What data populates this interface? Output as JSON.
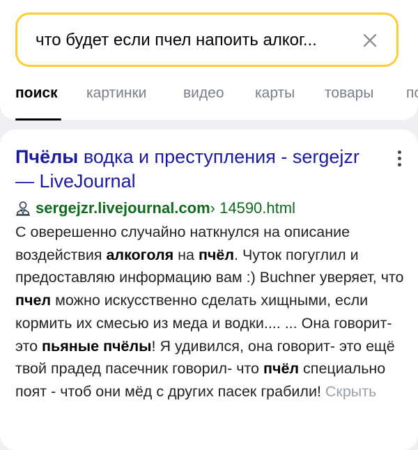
{
  "search": {
    "query": "что будет если пчел напоить алког..."
  },
  "tabs": [
    {
      "label": "поиск",
      "active": true
    },
    {
      "label": "картинки"
    },
    {
      "label": "видео"
    },
    {
      "label": "карты"
    },
    {
      "label": "товары"
    },
    {
      "label": "по"
    }
  ],
  "result": {
    "title_bold": "Пчёлы",
    "title_rest": " водка и преступления - sergejzr — LiveJournal",
    "domain": "sergejzr.livejournal.com",
    "path": " › 14590.html",
    "snippet": [
      {
        "t": "С оверешенно случайно наткнулся на описание воздействия "
      },
      {
        "t": "алкоголя",
        "b": true
      },
      {
        "t": " на "
      },
      {
        "t": "пчёл",
        "b": true
      },
      {
        "t": ". Чуток погуглил и предоставляю информацию вам :) Buchner уверяет, что "
      },
      {
        "t": "пчел",
        "b": true
      },
      {
        "t": " можно искусственно сделать хищными, если кормить их смесью из меда и водки.... ... Она говорит- это "
      },
      {
        "t": "пьяные пчёлы",
        "b": true
      },
      {
        "t": "! Я удивился, она говорит- это ещё твой прадед пасечник говорил- что "
      },
      {
        "t": "пчёл",
        "b": true
      },
      {
        "t": " специально поят - чтоб они мёд с других пасек грабили! "
      }
    ],
    "hide_label": "Скрыть"
  },
  "colors": {
    "accent_border": "#ffcc32",
    "title_link": "#1a1a9f",
    "url_green": "#0f6b1d"
  },
  "icons": {
    "clear": "close-icon",
    "more": "more-vertical-icon",
    "favicon": "livejournal-user-icon"
  }
}
